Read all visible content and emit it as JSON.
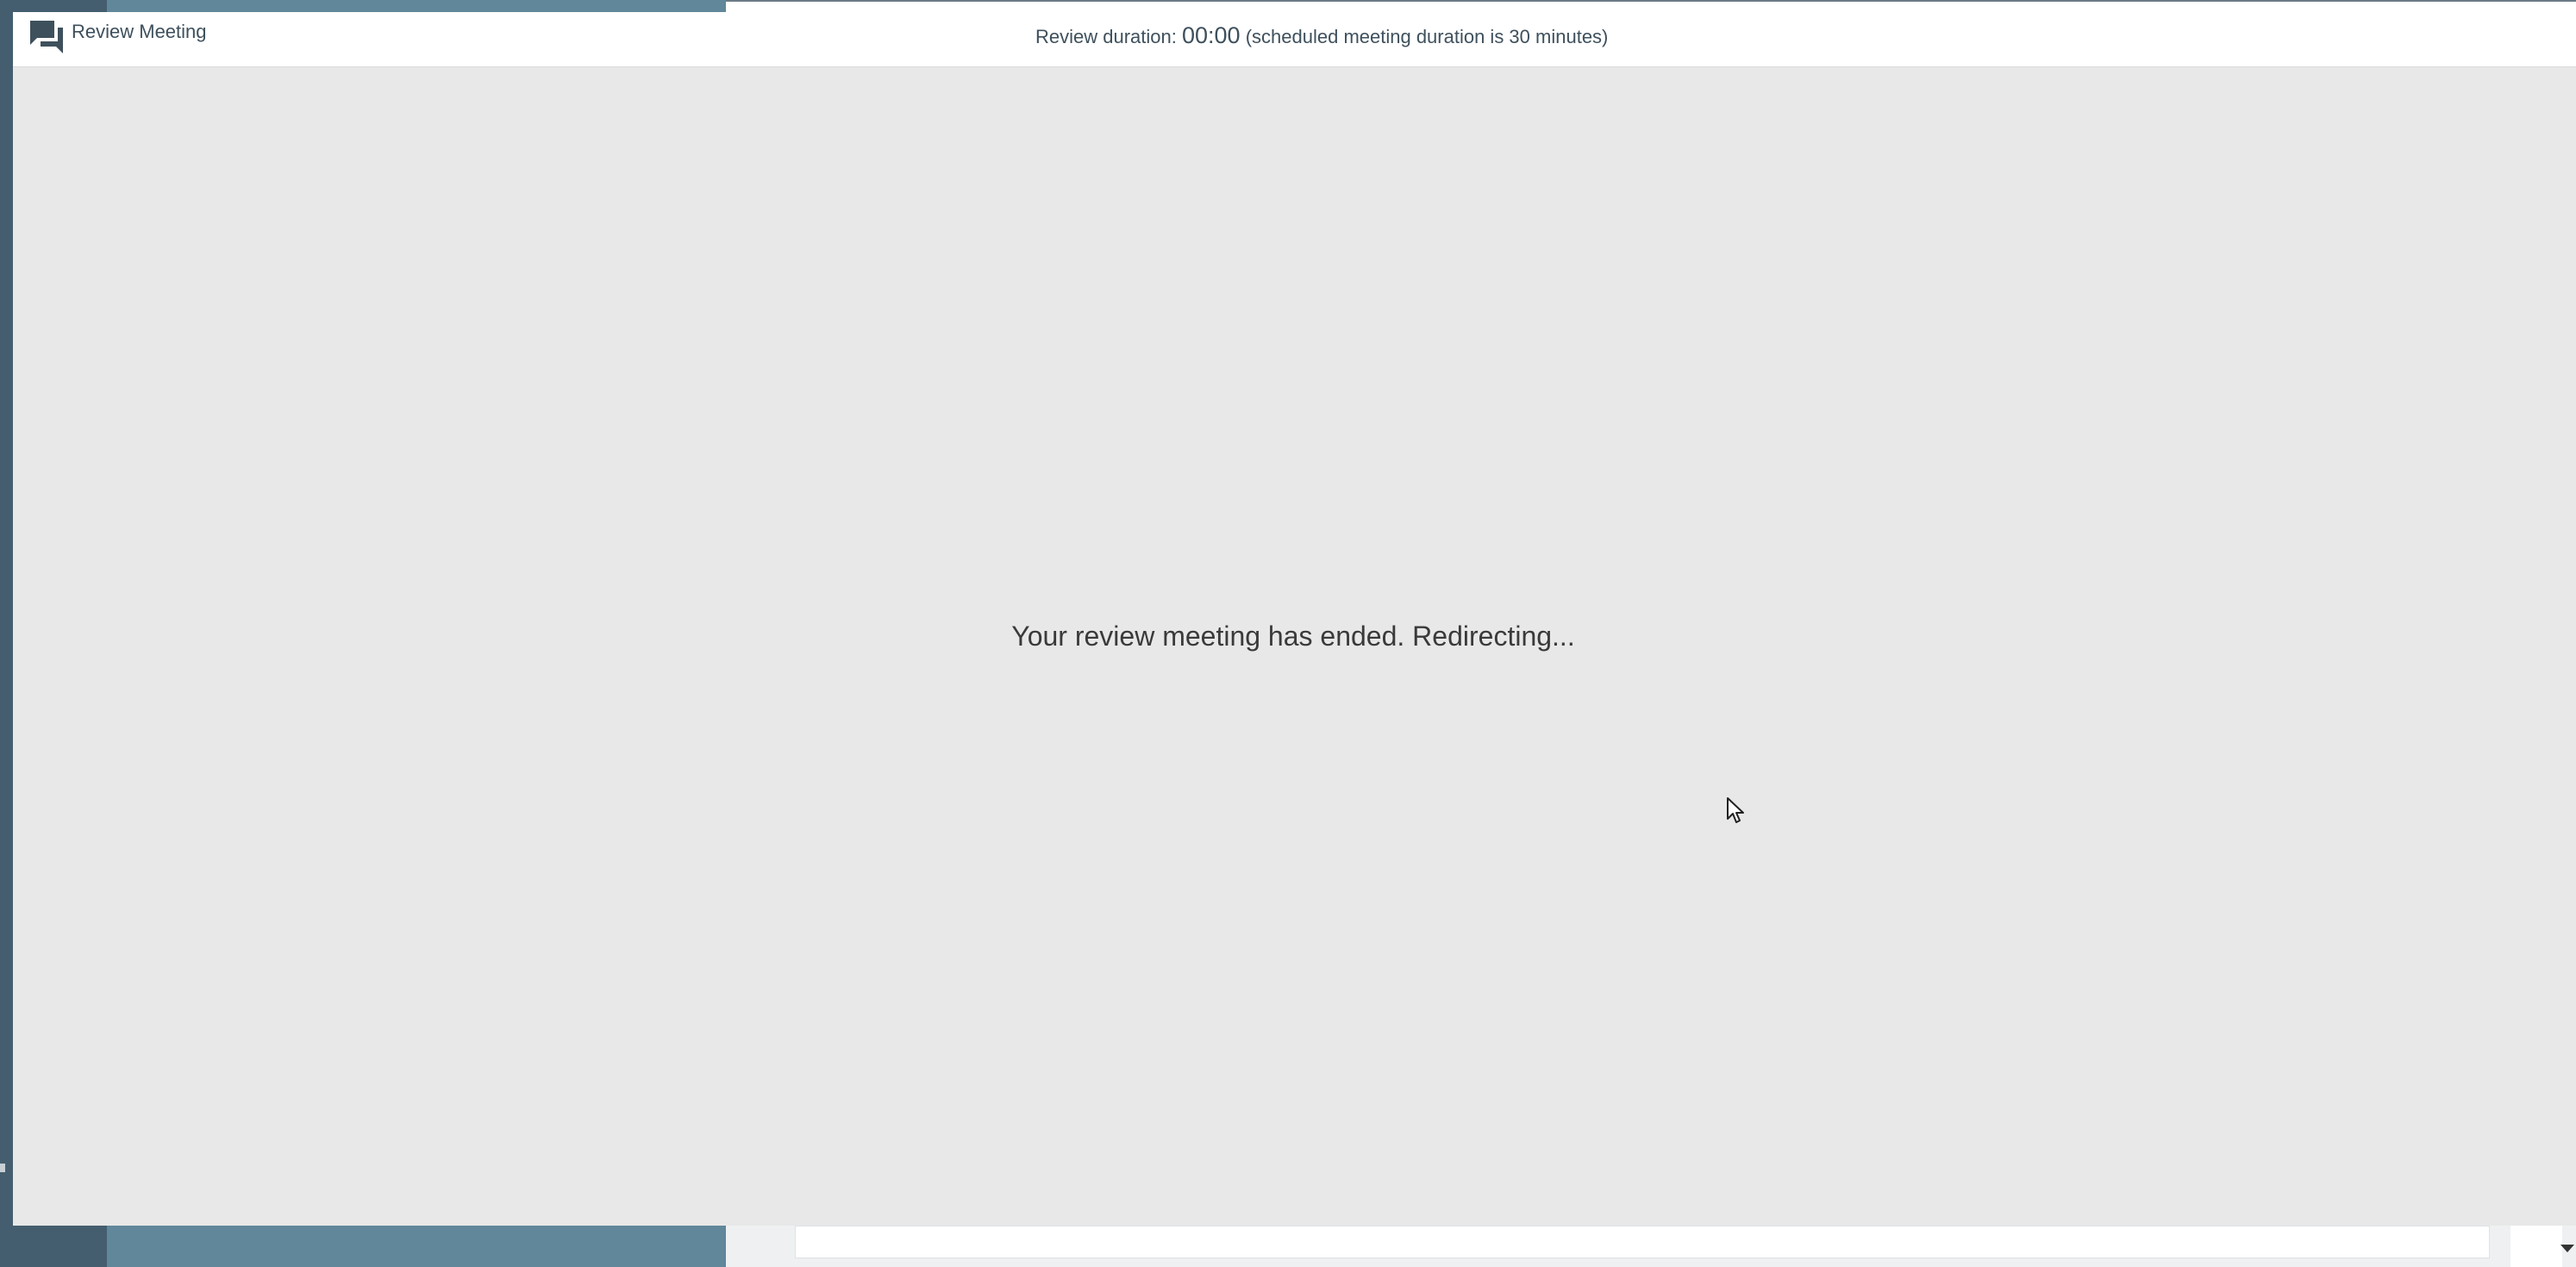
{
  "header": {
    "title": "Review Meeting",
    "duration_label": "Review duration:",
    "duration_time": "00:00",
    "duration_note": "(scheduled meeting duration is 30 minutes)"
  },
  "main": {
    "message": "Your review meeting has ended. Redirecting..."
  },
  "icons": {
    "header_icon": "chat-bubbles-icon",
    "cursor": "mouse-pointer-icon"
  },
  "colors": {
    "header_text": "#3e505c",
    "overlay_bg": "#e8e8e8",
    "sidebar_dark": "#445e6f",
    "sidebar_light": "#60879a"
  }
}
